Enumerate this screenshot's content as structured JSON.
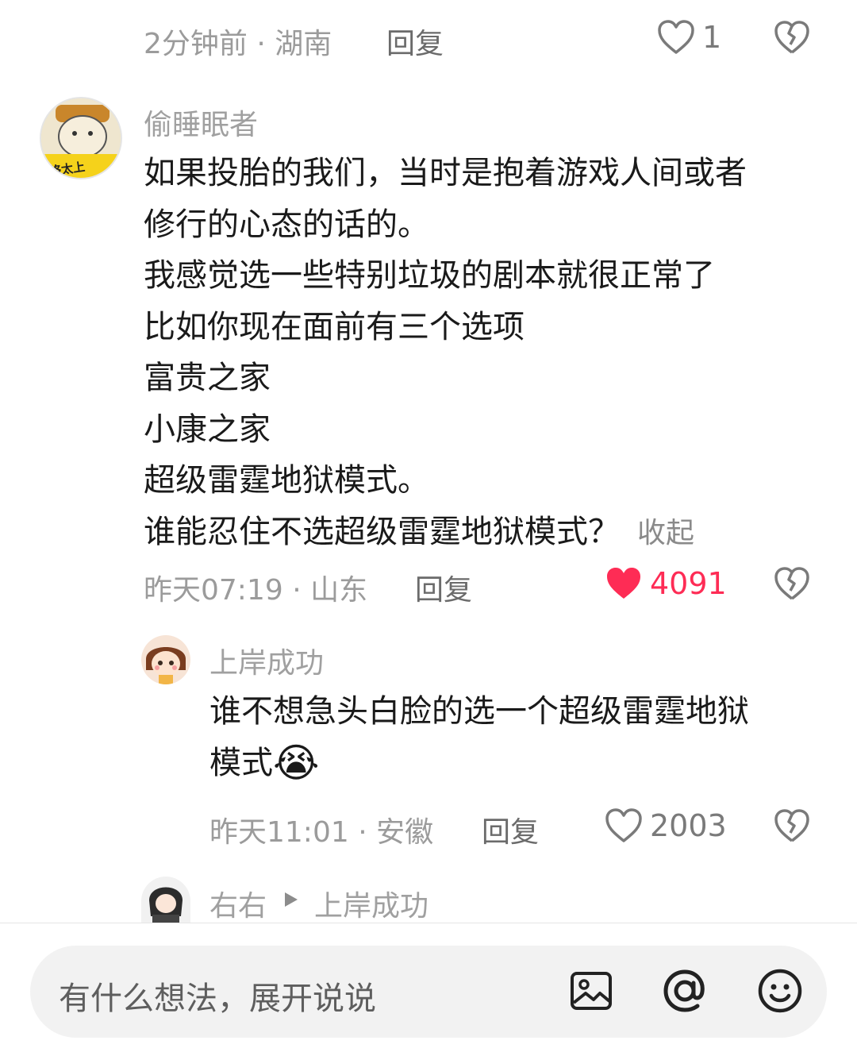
{
  "top_comment_meta": {
    "time_location": "2分钟前 · 湖南",
    "reply_label": "回复",
    "like_count": "1"
  },
  "comment_main": {
    "username": "偷睡眠者",
    "avatar_text": "络太上",
    "lines": [
      "如果投胎的我们，当时是抱着游戏人间或者",
      "修行的心态的话的。",
      "我感觉选一些特别垃圾的剧本就很正常了",
      "比如你现在面前有三个选项",
      "富贵之家",
      "小康之家",
      "超级雷霆地狱模式。",
      "谁能忍住不选超级雷霆地狱模式？"
    ],
    "collapse_label": "收起",
    "time_location": "昨天07:19 · 山东",
    "reply_label": "回复",
    "like_count": "4091",
    "like_color": "#fe2c55"
  },
  "reply_1": {
    "username": "上岸成功",
    "lines": [
      "谁不想急头白脸的选一个超级雷霆地狱",
      "模式"
    ],
    "emoji": "😭",
    "time_location": "昨天11:01 · 安徽",
    "reply_label": "回复",
    "like_count": "2003"
  },
  "reply_2": {
    "username": "右右",
    "reply_to": "上岸成功"
  },
  "bottom_bar": {
    "placeholder": "有什么想法，展开说说",
    "icons": [
      "image-icon",
      "at-icon",
      "emoji-icon"
    ]
  }
}
